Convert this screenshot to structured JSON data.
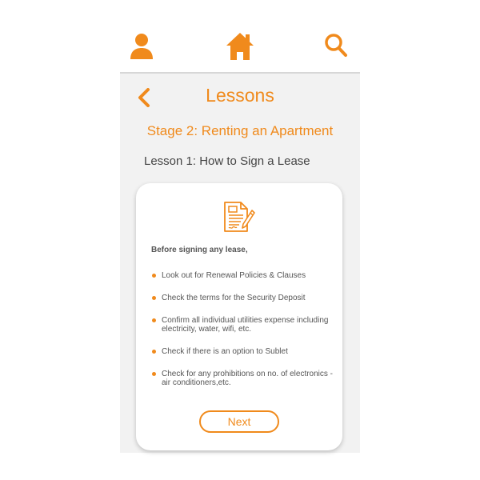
{
  "colors": {
    "accent": "#f08a1c",
    "text": "#555555",
    "background": "#f2f2f2"
  },
  "topbar": {
    "icons": [
      "user-icon",
      "home-icon",
      "search-icon"
    ]
  },
  "header": {
    "back_icon": "chevron-left-icon",
    "title": "Lessons"
  },
  "stage_title": "Stage 2: Renting an Apartment",
  "lesson_title": "Lesson 1: How to Sign a Lease",
  "card": {
    "icon": "document-pen-icon",
    "intro": "Before signing any lease,",
    "items": [
      {
        "text": "Look out for Renewal Policies & Clauses"
      },
      {
        "text": "Check the terms for the Security Deposit"
      },
      {
        "text": "Confirm all individual utilities expense including electricity, water, wifi, etc."
      },
      {
        "text": "Check if there is an option to Sublet"
      },
      {
        "text": "Check for any prohibitions on no. of electronics - air conditioners,etc."
      }
    ],
    "next_label": "Next"
  }
}
